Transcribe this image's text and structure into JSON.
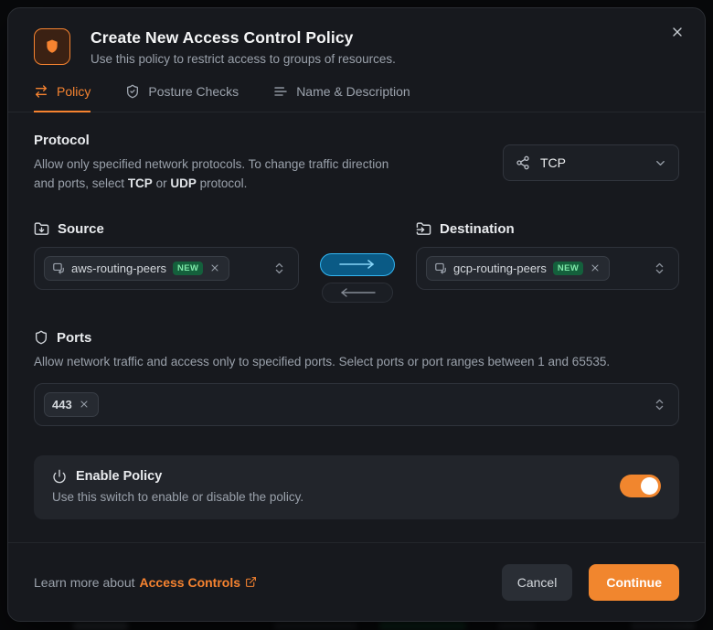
{
  "header": {
    "title": "Create New Access Control Policy",
    "subtitle": "Use this policy to restrict access to groups of resources."
  },
  "tabs": {
    "policy": "Policy",
    "posture_checks": "Posture Checks",
    "name_description": "Name & Description"
  },
  "protocol": {
    "heading": "Protocol",
    "desc_text_1": "Allow only specified network protocols. To change traffic direction and ports, select ",
    "desc_bold_1": "TCP",
    "desc_text_2": " or ",
    "desc_bold_2": "UDP",
    "desc_text_3": " protocol.",
    "selected_value": "TCP"
  },
  "source": {
    "heading": "Source",
    "tag": {
      "name": "aws-routing-peers",
      "badge": "NEW"
    }
  },
  "destination": {
    "heading": "Destination",
    "tag": {
      "name": "gcp-routing-peers",
      "badge": "NEW"
    }
  },
  "direction": {
    "active": "left-to-right"
  },
  "ports": {
    "heading": "Ports",
    "description": "Allow network traffic and access only to specified ports. Select ports or port ranges between 1 and 65535.",
    "tag": "443"
  },
  "enable_policy": {
    "title": "Enable Policy",
    "description": "Use this switch to enable or disable the policy.",
    "enabled": true
  },
  "footer": {
    "learn_more_text": "Learn more about",
    "link_label": "Access Controls",
    "cancel_label": "Cancel",
    "continue_label": "Continue"
  },
  "colors": {
    "accent_orange": "#f68330",
    "continue_button": "#f1862e",
    "direction_active_border": "#33b5f1",
    "direction_active_bg": "#0a5a85",
    "badge_green_bg": "#14603c",
    "badge_green_text": "#7ee8a9",
    "modal_bg": "#17191e",
    "card_bg": "#22252b"
  }
}
